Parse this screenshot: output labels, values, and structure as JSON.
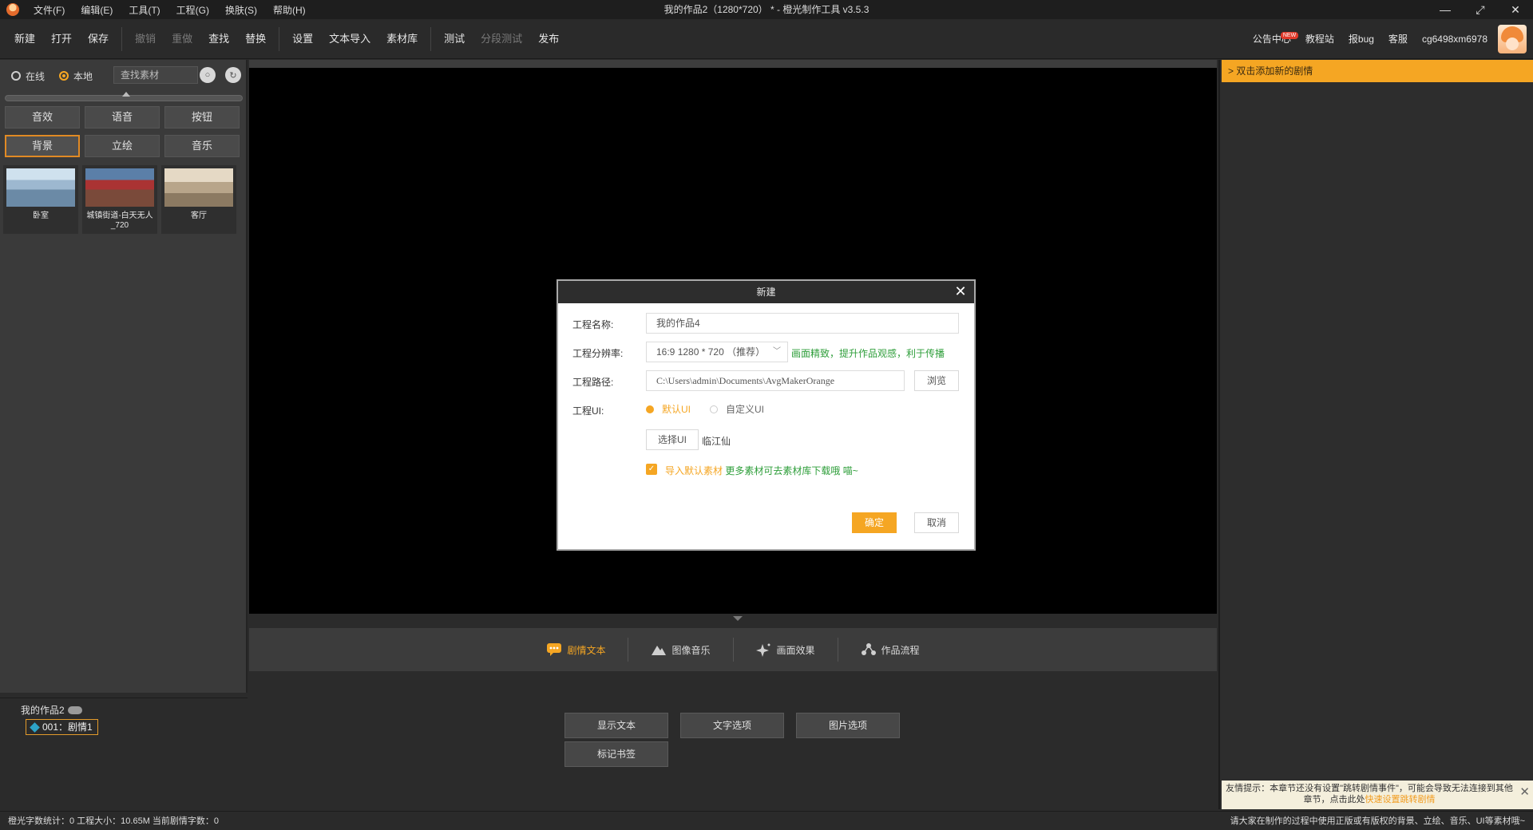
{
  "window": {
    "title": "我的作品2（1280*720） * - 橙光制作工具 v3.5.3",
    "menu": [
      "文件(F)",
      "编辑(E)",
      "工具(T)",
      "工程(G)",
      "换肤(S)",
      "帮助(H)"
    ]
  },
  "toolbar": {
    "group1": [
      "新建",
      "打开",
      "保存"
    ],
    "group2": [
      "撤销",
      "重做",
      "查找",
      "替换"
    ],
    "group3": [
      "设置",
      "文本导入",
      "素材库"
    ],
    "group4": [
      "测试",
      "分段测试",
      "发布"
    ],
    "right": {
      "announcements": "公告中心",
      "new_badge": "NEW",
      "tutorials": "教程站",
      "report_bug": "报bug",
      "support": "客服",
      "username": "cg6498xm6978"
    }
  },
  "left_panel": {
    "source_online": "在线",
    "source_local": "本地",
    "search_placeholder": "查找素材",
    "categories": [
      "音效",
      "语音",
      "按钮",
      "背景",
      "立绘",
      "音乐"
    ],
    "active_category": "背景",
    "assets": [
      {
        "label": "卧室"
      },
      {
        "label": "城镇街道-白天无人_720"
      },
      {
        "label": "客厅"
      }
    ]
  },
  "project_tree": {
    "root": "我的作品2",
    "node": "001：剧情1"
  },
  "bottom": {
    "tabs": [
      "剧情文本",
      "图像音乐",
      "画面效果",
      "作品流程"
    ],
    "active_tab": "剧情文本",
    "actions": {
      "show_text": "显示文本",
      "text_options": "文字选项",
      "image_options": "图片选项",
      "bookmark": "标记书签"
    }
  },
  "right_panel": {
    "hint": "> 双击添加新的剧情",
    "tip_prefix": "友情提示：本章节还没有设置\"跳转剧情事件\"，可能会导致无法连接到其他章节，点击此处",
    "tip_link": "快速设置跳转剧情"
  },
  "statusbar": {
    "left": "橙光字数统计：0 工程大小：10.65M 当前剧情字数：0",
    "right": "请大家在制作的过程中使用正版或有版权的背景、立绘、音乐、UI等素材哦~"
  },
  "dialog": {
    "title": "新建",
    "name_label": "工程名称:",
    "name_value": "我的作品4",
    "resolution_label": "工程分辨率:",
    "resolution_value": "16:9 1280 * 720 （推荐）",
    "resolution_note": "画面精致，提升作品观感，利于传播",
    "path_label": "工程路径:",
    "path_value": "C:\\Users\\admin\\Documents\\AvgMakerOrange",
    "browse": "浏览",
    "ui_label": "工程UI:",
    "ui_default": "默认UI",
    "ui_custom": "自定义UI",
    "select_ui": "选择UI",
    "ui_name": "临江仙",
    "import_label": "导入默认素材",
    "import_note": "更多素材可去素材库下载哦 喵~",
    "confirm": "确定",
    "cancel": "取消"
  },
  "colors": {
    "accent": "#f5a623",
    "green_note": "#2e9e3a",
    "panel": "#3a3a3a",
    "canvas": "#000000"
  }
}
